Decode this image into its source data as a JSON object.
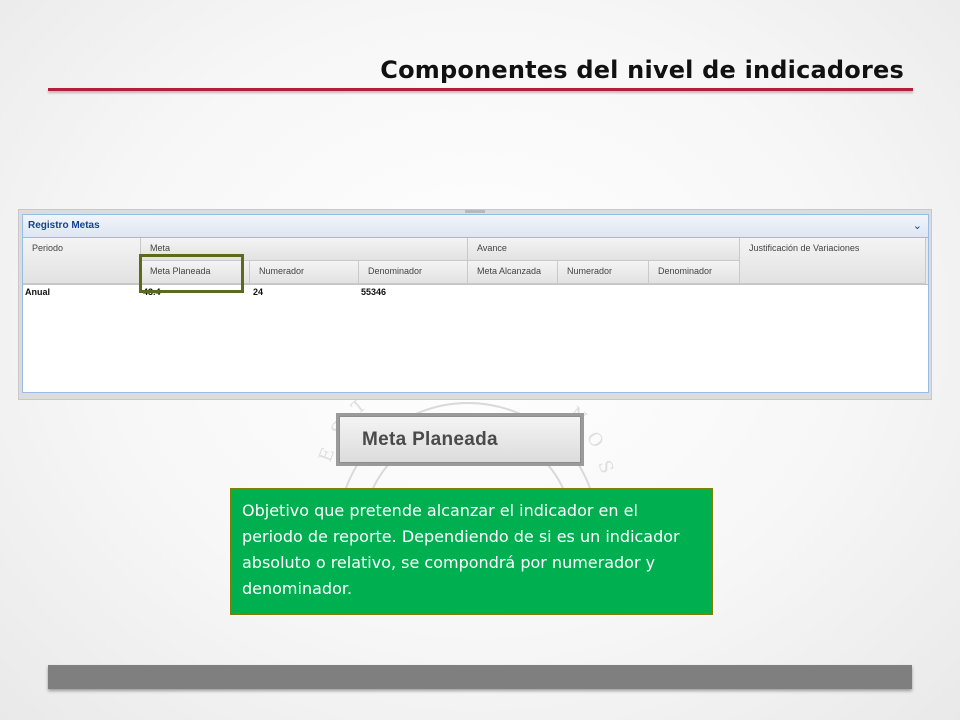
{
  "slide": {
    "title": "Componentes del nivel de indicadores"
  },
  "panel": {
    "title": "Registro Metas",
    "collapse_icon": "chevron-down-icon",
    "header_groups": {
      "periodo": "Periodo",
      "meta": "Meta",
      "avance": "Avance",
      "justificacion": "Justificación de Variaciones"
    },
    "subheaders": {
      "meta_planeada": "Meta Planeada",
      "meta_numerador": "Numerador",
      "meta_denominador": "Denominador",
      "meta_alcanzada": "Meta Alcanzada",
      "avance_numerador": "Numerador",
      "avance_denominador": "Denominador"
    },
    "rows": [
      {
        "periodo": "Anual",
        "meta_planeada": "43.4",
        "numerador": "24",
        "denominador": "55346"
      }
    ]
  },
  "zoom_label": "Meta Planeada",
  "note": {
    "text": "Objetivo que pretende alcanzar el indicador en el periodo de reporte.  Dependiendo de si es un indicador absoluto o relativo, se compondrá por numerador y denominador."
  },
  "colors": {
    "title_rule": "#b21f3a",
    "note_bg": "#00b050",
    "highlight": "#5b6b1a",
    "footer_bar": "#7f7f7f"
  }
}
